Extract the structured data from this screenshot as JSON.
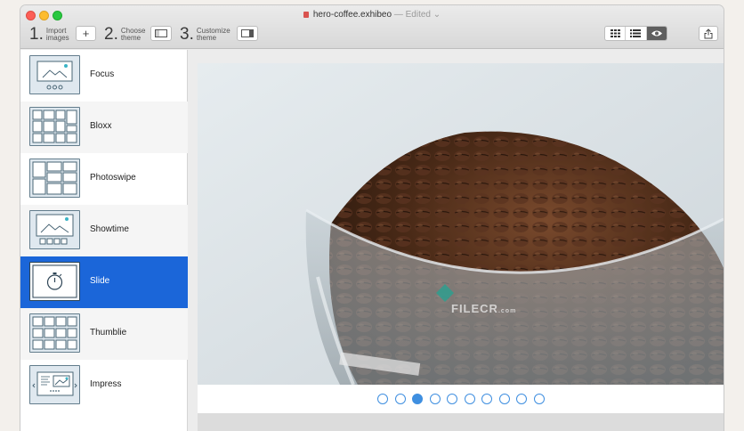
{
  "window": {
    "filename": "hero-coffee.exhibeo",
    "status": "— Edited"
  },
  "toolbar": {
    "steps": [
      {
        "num": "1.",
        "line1": "Import",
        "line2": "images"
      },
      {
        "num": "2.",
        "line1": "Choose",
        "line2": "theme"
      },
      {
        "num": "3.",
        "line1": "Customize",
        "line2": "theme"
      }
    ],
    "add_label": "+",
    "view_modes": [
      "grid-view-icon",
      "list-view-icon",
      "preview-eye-icon"
    ]
  },
  "themes": [
    {
      "label": "Focus",
      "icon": "focus-theme-icon"
    },
    {
      "label": "Bloxx",
      "icon": "bloxx-theme-icon"
    },
    {
      "label": "Photoswipe",
      "icon": "photoswipe-theme-icon"
    },
    {
      "label": "Showtime",
      "icon": "showtime-theme-icon"
    },
    {
      "label": "Slide",
      "icon": "slide-theme-icon",
      "selected": true
    },
    {
      "label": "Thumblie",
      "icon": "thumblie-theme-icon"
    },
    {
      "label": "Impress",
      "icon": "impress-theme-icon"
    }
  ],
  "preview": {
    "watermark": "FILECR",
    "watermark_sub": ".com",
    "slide_count": 10,
    "active_slide": 3
  },
  "colors": {
    "accent": "#1b66d9",
    "dot": "#3f8fe0"
  }
}
